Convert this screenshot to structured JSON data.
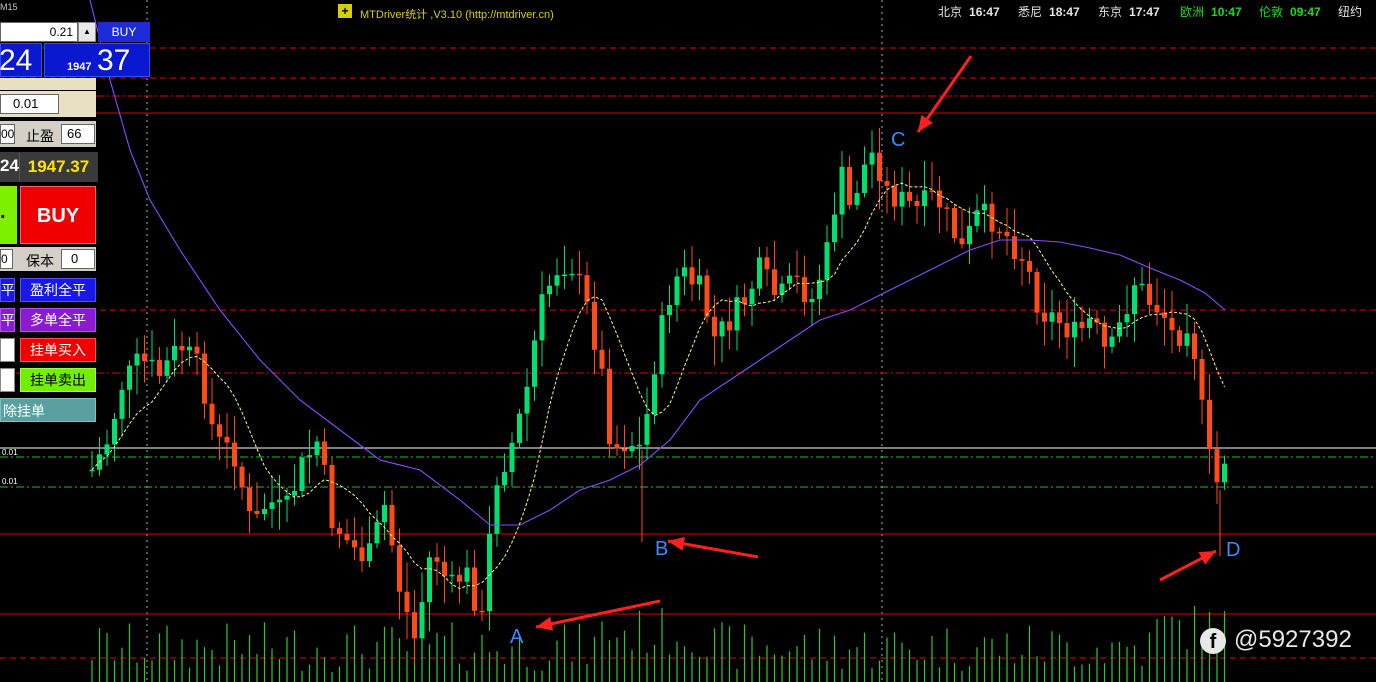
{
  "topbar": {
    "corner_label": "M15",
    "indicator_title": "MTDriver统计 ,V3.10 (http://mtdriver.cn)",
    "clocks": [
      {
        "city": "北京",
        "time": "16:47"
      },
      {
        "city": "悉尼",
        "time": "18:47"
      },
      {
        "city": "东京",
        "time": "17:47"
      },
      {
        "city": "欧洲",
        "time": "10:47"
      },
      {
        "city": "伦敦",
        "time": "09:47"
      },
      {
        "city": "纽约",
        "time": ""
      }
    ]
  },
  "panel": {
    "price_input": "0.21",
    "spin": "▲",
    "buy_small": "BUY",
    "bid_big": "24",
    "ask_small": "1947",
    "ask_big": "37",
    "lots": "0.01",
    "sl_left": "00",
    "sl_label": "止盈",
    "tp_value": "66",
    "bid_cut": "24",
    "ask_price": "1947.37",
    "sell_glyph": ".",
    "buy_label": "BUY",
    "be_left": "0",
    "be_label": "保本",
    "be_value": "0",
    "btn_close_left": "平",
    "btn_close_profit": "盈利全平",
    "btn_buy_close_left": "平",
    "btn_buy_close": "多单全平",
    "btn_pending_buy": "挂单买入",
    "btn_pending_sell": "挂单卖出",
    "btn_delete_pending": "除挂单"
  },
  "axis_labels": {
    "a": "0.01",
    "b": "0.01"
  },
  "markers": {
    "A": "A",
    "B": "B",
    "C": "C",
    "D": "D"
  },
  "watermark": {
    "icon": "f",
    "text": "@5927392"
  },
  "colors": {
    "bull": "#00e070",
    "bear": "#ff4a1a",
    "ma_slow": "#8a4cff",
    "ma_fast": "#ffff80",
    "level": "#e00000",
    "arrow": "#ff2020",
    "label": "#3a8cff"
  },
  "chart_data": {
    "type": "candlestick",
    "title": "",
    "xlabel": "",
    "ylabel": "",
    "candles_approx": 150
  }
}
